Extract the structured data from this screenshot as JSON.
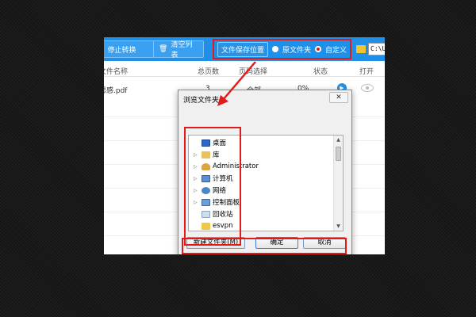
{
  "toolbar": {
    "stop_label": "停止转换",
    "clear_label": "清空列表",
    "save_location_label": "文件保存位置",
    "options": [
      {
        "label": "原文件夹",
        "selected": false
      },
      {
        "label": "自定义",
        "selected": true
      }
    ],
    "path_value": "C:\\U"
  },
  "table": {
    "columns": [
      "文件名称",
      "总页数",
      "页码选择",
      "状态",
      "打开"
    ],
    "rows": [
      {
        "name": "思感.pdf",
        "pages": "3",
        "range": "全部",
        "progress": "0%"
      }
    ]
  },
  "dialog": {
    "title": "浏览文件夹",
    "close_glyph": "✕",
    "tree": [
      {
        "label": "桌面",
        "icon": "desktop-icon",
        "expandable": false
      },
      {
        "label": "库",
        "icon": "library-icon",
        "expandable": true
      },
      {
        "label": "Administrator",
        "icon": "user-folder-icon",
        "expandable": true
      },
      {
        "label": "计算机",
        "icon": "computer-icon",
        "expandable": true
      },
      {
        "label": "网络",
        "icon": "network-icon",
        "expandable": true
      },
      {
        "label": "控制面板",
        "icon": "control-panel-icon",
        "expandable": true
      },
      {
        "label": "回收站",
        "icon": "recycle-bin-icon",
        "expandable": false
      },
      {
        "label": "esvpn",
        "icon": "folder-icon",
        "expandable": false
      }
    ],
    "buttons": {
      "new_folder": "新建文件夹(M)",
      "ok": "确定",
      "cancel": "取消"
    }
  },
  "colors": {
    "toolbar_blue": "#1f8fe8",
    "highlight_red": "#e11b1b",
    "background_dark": "#151515"
  }
}
